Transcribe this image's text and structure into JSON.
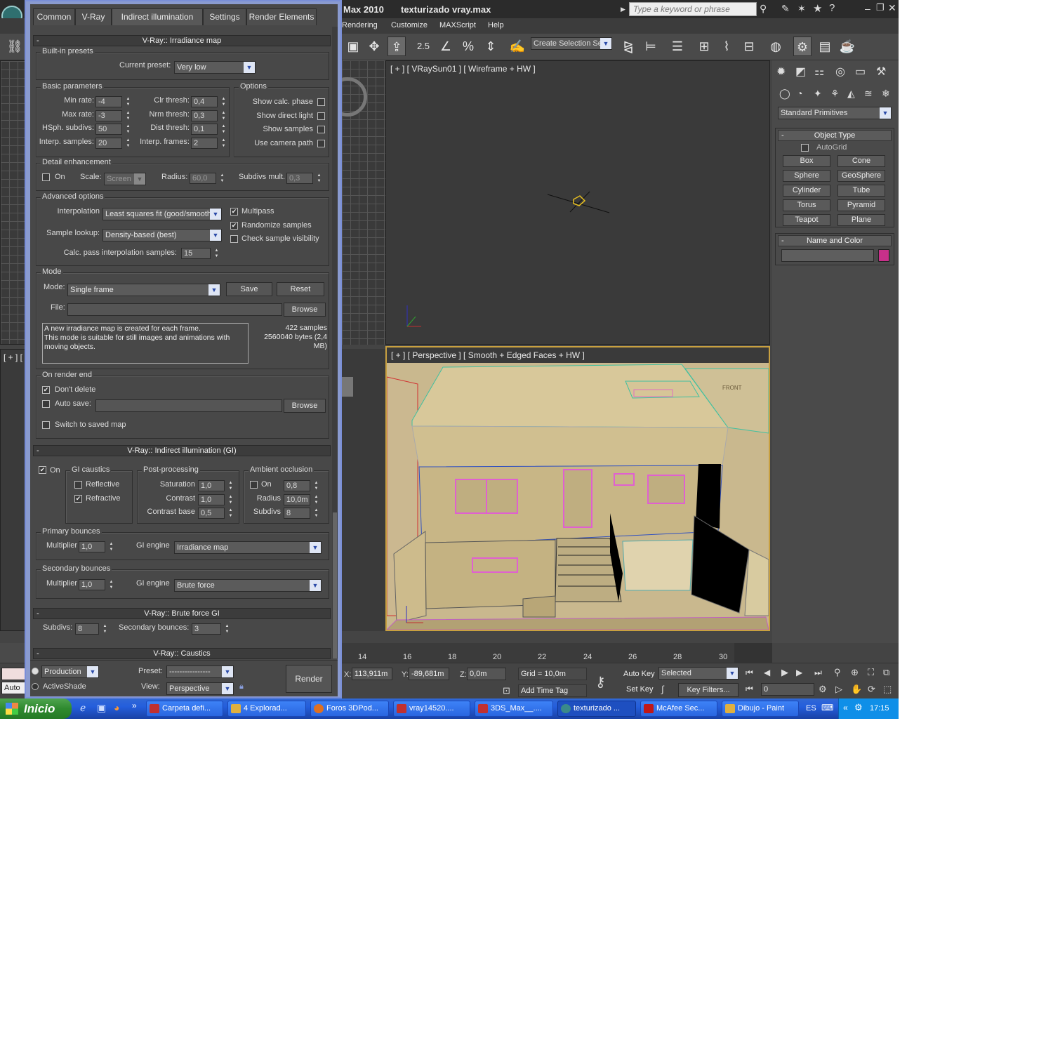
{
  "app": {
    "title_app": "Max  2010",
    "title_file": "texturizado vray.max",
    "search_placeholder": "Type a keyword or phrase"
  },
  "menus": [
    "Rendering",
    "Customize",
    "MAXScript",
    "Help"
  ],
  "toolbar": {
    "selection_set": "Create Selection Se",
    "snap_label": "2.5"
  },
  "viewports": {
    "top_right_label": "[ + ] [ VRaySun01 ] [ Wireframe + HW ]",
    "persp_label": "[ + ] [ Perspective ] [ Smooth + Edged Faces + HW ]",
    "left_partial_label": "[ + ] [",
    "front_label": "FRONT"
  },
  "command_panel": {
    "category": "Standard Primitives",
    "object_type_title": "Object Type",
    "autogrid": "AutoGrid",
    "buttons": [
      "Box",
      "Cone",
      "Sphere",
      "GeoSphere",
      "Cylinder",
      "Tube",
      "Torus",
      "Pyramid",
      "Teapot",
      "Plane"
    ],
    "name_color_title": "Name and Color",
    "object_color": "#c8308a"
  },
  "timeline": {
    "ticks": [
      "14",
      "16",
      "18",
      "20",
      "22",
      "24",
      "26",
      "28",
      "30"
    ]
  },
  "status": {
    "x_label": "X:",
    "x": "113,911m",
    "y_label": "Y:",
    "y": "-89,681m",
    "z_label": "Z:",
    "z": "0,0m",
    "grid": "Grid = 10,0m",
    "add_time_tag": "Add Time Tag",
    "auto_key": "Auto Key",
    "set_key": "Set Key",
    "selected": "Selected",
    "key_filters": "Key Filters...",
    "frame": "0",
    "left_partial": "Auto"
  },
  "taskbar": {
    "start": "Inicio",
    "items": [
      {
        "label": "Carpeta defi...",
        "color": "#c03030"
      },
      {
        "label": "4 Explorad...",
        "color": "#e0b040"
      },
      {
        "label": "Foros 3DPod...",
        "color": "#e07020"
      },
      {
        "label": "vray14520....",
        "color": "#c03030"
      },
      {
        "label": "3DS_Max__....",
        "color": "#c03030"
      },
      {
        "label": "texturizado ...",
        "color": "#3a8a8a"
      },
      {
        "label": "McAfee Sec...",
        "color": "#c01818"
      },
      {
        "label": "Dibujo - Paint",
        "color": "#e0b040"
      }
    ],
    "lang": "ES",
    "clock": "17:15"
  },
  "dialog": {
    "tabs": [
      "Common",
      "V-Ray",
      "Indirect illumination",
      "Settings",
      "Render Elements"
    ],
    "irr_title": "V-Ray:: Irradiance map",
    "presets": {
      "group": "Built-in presets",
      "label": "Current preset:",
      "value": "Very low"
    },
    "basic": {
      "group": "Basic parameters",
      "min_rate_l": "Min rate:",
      "min_rate": "-4",
      "max_rate_l": "Max rate:",
      "max_rate": "-3",
      "hsph_l": "HSph. subdivs:",
      "hsph": "50",
      "interp_l": "Interp. samples:",
      "interp": "20",
      "clr_l": "Clr thresh:",
      "clr": "0,4",
      "nrm_l": "Nrm thresh:",
      "nrm": "0,3",
      "dist_l": "Dist thresh:",
      "dist": "0,1",
      "frames_l": "Interp. frames:",
      "frames": "2"
    },
    "options": {
      "group": "Options",
      "calc_phase": "Show calc. phase",
      "direct_light": "Show direct light",
      "show_samples": "Show samples",
      "camera_path": "Use camera path"
    },
    "detail": {
      "group": "Detail enhancement",
      "on": "On",
      "scale_l": "Scale:",
      "scale": "Screen",
      "radius_l": "Radius:",
      "radius": "60,0",
      "subdivs_l": "Subdivs mult.",
      "subdivs": "0,3"
    },
    "advanced": {
      "group": "Advanced options",
      "interp_l": "Interpolation",
      "interp": "Least squares fit (good/smooth",
      "lookup_l": "Sample lookup:",
      "lookup": "Density-based (best)",
      "calcpass_l": "Calc. pass interpolation samples:",
      "calcpass": "15",
      "multipass": "Multipass",
      "randomize": "Randomize samples",
      "visibility": "Check sample visibility"
    },
    "mode": {
      "group": "Mode",
      "mode_l": "Mode:",
      "mode": "Single frame",
      "save": "Save",
      "reset": "Reset",
      "file_l": "File:",
      "browse": "Browse",
      "desc1": "A new irradiance map is created for each frame.",
      "desc2": "This mode is suitable for still images and animations with",
      "desc3": "moving objects.",
      "samples": "422 samples",
      "bytes": "2560040 bytes (2,4",
      "mb": "MB)"
    },
    "render_end": {
      "group": "On render end",
      "dont_delete": "Don't delete",
      "auto_save": "Auto save:",
      "browse": "Browse",
      "switch": "Switch to saved map"
    },
    "gi_title": "V-Ray:: Indirect illumination (GI)",
    "gi": {
      "on": "On",
      "caustics": "GI caustics",
      "reflective": "Reflective",
      "refractive": "Refractive",
      "post": "Post-processing",
      "sat_l": "Saturation",
      "sat": "1,0",
      "con_l": "Contrast",
      "con": "1,0",
      "cbase_l": "Contrast base",
      "cbase": "0,5",
      "ao": "Ambient occlusion",
      "ao_on": "On",
      "ao_val": "0,8",
      "ao_rad_l": "Radius",
      "ao_rad": "10,0m",
      "ao_sub_l": "Subdivs",
      "ao_sub": "8"
    },
    "primary": {
      "group": "Primary bounces",
      "mult_l": "Multiplier",
      "mult": "1,0",
      "engine_l": "GI engine",
      "engine": "Irradiance map"
    },
    "secondary": {
      "group": "Secondary bounces",
      "mult_l": "Multiplier",
      "mult": "1,0",
      "engine_l": "GI engine",
      "engine": "Brute force"
    },
    "bf_title": "V-Ray:: Brute force GI",
    "bf": {
      "subdivs_l": "Subdivs:",
      "subdivs": "8",
      "bounces_l": "Secondary bounces:",
      "bounces": "3"
    },
    "caustics_title": "V-Ray:: Caustics",
    "footer": {
      "production": "Production",
      "activeshade": "ActiveShade",
      "preset_l": "Preset:",
      "preset": "----------------",
      "view_l": "View:",
      "view": "Perspective",
      "render": "Render"
    }
  }
}
